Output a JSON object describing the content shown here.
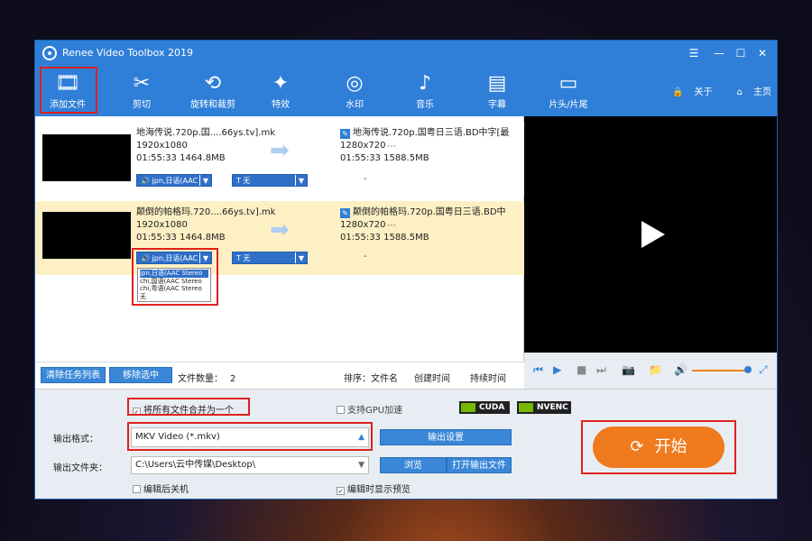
{
  "window": {
    "title": "Renee Video Toolbox 2019",
    "ctl_menu": "☰",
    "ctl_min": "—",
    "ctl_max": "☐",
    "ctl_close": "✕"
  },
  "toolbar": {
    "items": [
      {
        "label": "添加文件",
        "icon": "add-file-icon"
      },
      {
        "label": "剪切",
        "icon": "scissors-icon"
      },
      {
        "label": "旋转和裁剪",
        "icon": "rotate-crop-icon"
      },
      {
        "label": "特效",
        "icon": "effects-icon"
      },
      {
        "label": "水印",
        "icon": "watermark-icon"
      },
      {
        "label": "音乐",
        "icon": "music-icon"
      },
      {
        "label": "字幕",
        "icon": "subtitle-icon"
      },
      {
        "label": "片头/片尾",
        "icon": "intro-outro-icon"
      }
    ],
    "about": "关于",
    "home": "主页"
  },
  "files": [
    {
      "src_name": "地海传说.720p.国....66ys.tv].mk",
      "src_res": "1920x1080",
      "src_info": "01:55:33  1464.8MB",
      "dst_name": "地海传说.720p.国粤日三语.BD中字[最",
      "dst_res": "1280x720",
      "dst_info": "01:55:33  1588.5MB",
      "audio": "jpn,日语(AAC",
      "sub": "T  无",
      "dots": "⋯",
      "dash": "-"
    },
    {
      "src_name": "颠倒的帕格玛.720....66ys.tv].mk",
      "src_res": "1920x1080",
      "src_info": "01:55:33  1464.8MB",
      "dst_name": "颠倒的帕格玛.720p.国粤日三语.BD中",
      "dst_res": "1280x720",
      "dst_info": "01:55:33  1588.5MB",
      "audio": "jpn,日语(AAC",
      "sub": "T  无",
      "dots": "⋯",
      "dash": "-"
    }
  ],
  "audio_dropdown": [
    "jpn,日语(AAC Stereo",
    "chi,国语(AAC Stereo",
    "chi,粤语(AAC Stereo",
    "无"
  ],
  "list_bar": {
    "clear": "清除任务列表",
    "remove": "移除选中",
    "count_label": "文件数量：",
    "count": "2",
    "sort_label": "排序：",
    "sort_name": "文件名",
    "sort_ctime": "创建时间",
    "sort_dur": "持续时间"
  },
  "bottom": {
    "merge": "将所有文件合并为一个",
    "gpu": "支持GPU加速",
    "cuda": "CUDA",
    "nvenc": "NVENC",
    "format_label": "输出格式：",
    "format_value": "MKV Video (*.mkv)",
    "output_settings": "输出设置",
    "folder_label": "输出文件夹：",
    "folder_value": "C:\\Users\\云中传媒\\Desktop\\",
    "browse": "浏览",
    "open_folder": "打开输出文件",
    "shutdown": "编辑后关机",
    "show_preview": "编辑时显示预览",
    "start": "开始"
  },
  "colors": {
    "accent": "#2f7fd8",
    "highlight_row": "#fdf0c4",
    "start": "#f07a1e",
    "annotation": "#e02020"
  }
}
